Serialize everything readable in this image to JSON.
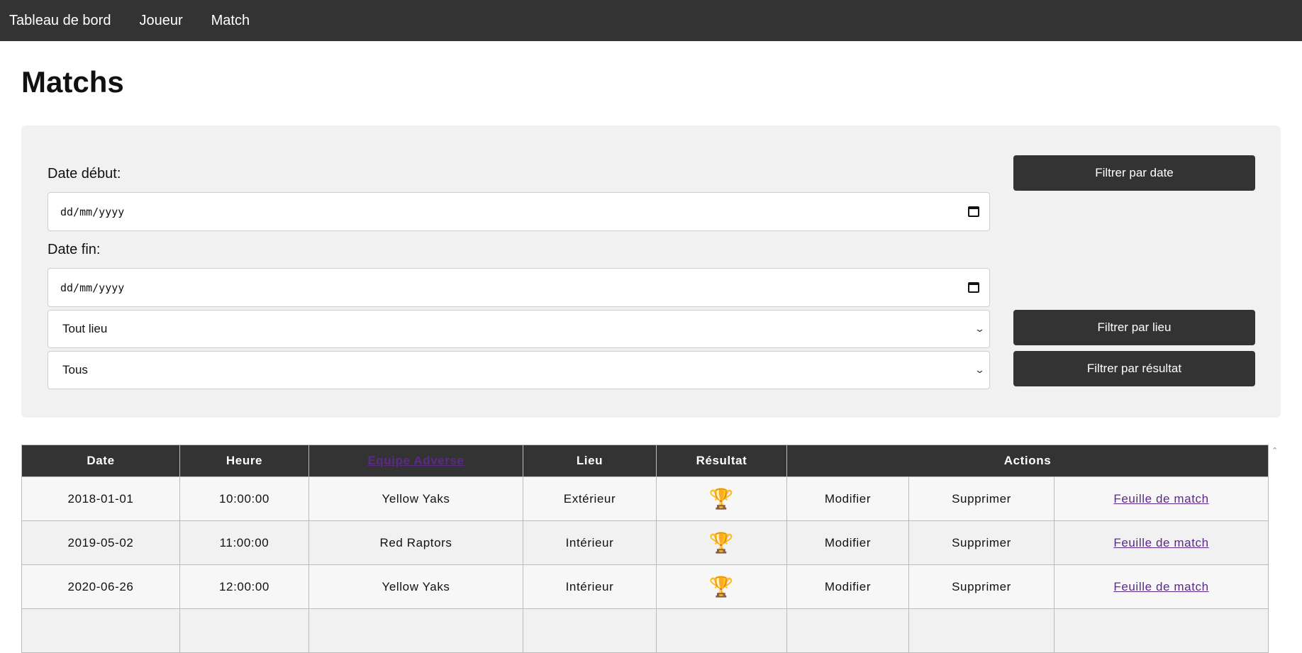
{
  "nav": {
    "items": [
      "Tableau de bord",
      "Joueur",
      "Match"
    ]
  },
  "page": {
    "title": "Matchs"
  },
  "filters": {
    "date_start_label": "Date début:",
    "date_start_placeholder": "dd/mm/yyyy",
    "date_end_label": "Date fin:",
    "date_end_placeholder": "dd/mm/yyyy",
    "location_selected": "Tout lieu",
    "result_selected": "Tous",
    "btn_date": "Filtrer par date",
    "btn_location": "Filtrer par lieu",
    "btn_result": "Filtrer par résultat"
  },
  "table": {
    "headers": {
      "date": "Date",
      "time": "Heure",
      "opponent": "Equipe Adverse",
      "location": "Lieu",
      "result": "Résultat",
      "actions": "Actions"
    },
    "rows": [
      {
        "date": "2018-01-01",
        "time": "10:00:00",
        "opponent": "Yellow Yaks",
        "location": "Extérieur",
        "result_icon": "trophy-gold-icon",
        "edit": "Modifier",
        "delete": "Supprimer",
        "sheet": "Feuille de match"
      },
      {
        "date": "2019-05-02",
        "time": "11:00:00",
        "opponent": "Red Raptors",
        "location": "Intérieur",
        "result_icon": "trophy-silver-icon",
        "edit": "Modifier",
        "delete": "Supprimer",
        "sheet": "Feuille de match"
      },
      {
        "date": "2020-06-26",
        "time": "12:00:00",
        "opponent": "Yellow Yaks",
        "location": "Intérieur",
        "result_icon": "trophy-gold-icon",
        "edit": "Modifier",
        "delete": "Supprimer",
        "sheet": "Feuille de match"
      }
    ]
  },
  "colors": {
    "nav_bg": "#333333",
    "panel_bg": "#f1f1f1",
    "button_bg": "#333333",
    "link": "#5b2a86",
    "trophy_gold": "#e5a822",
    "trophy_silver": "#c9c9c9"
  }
}
